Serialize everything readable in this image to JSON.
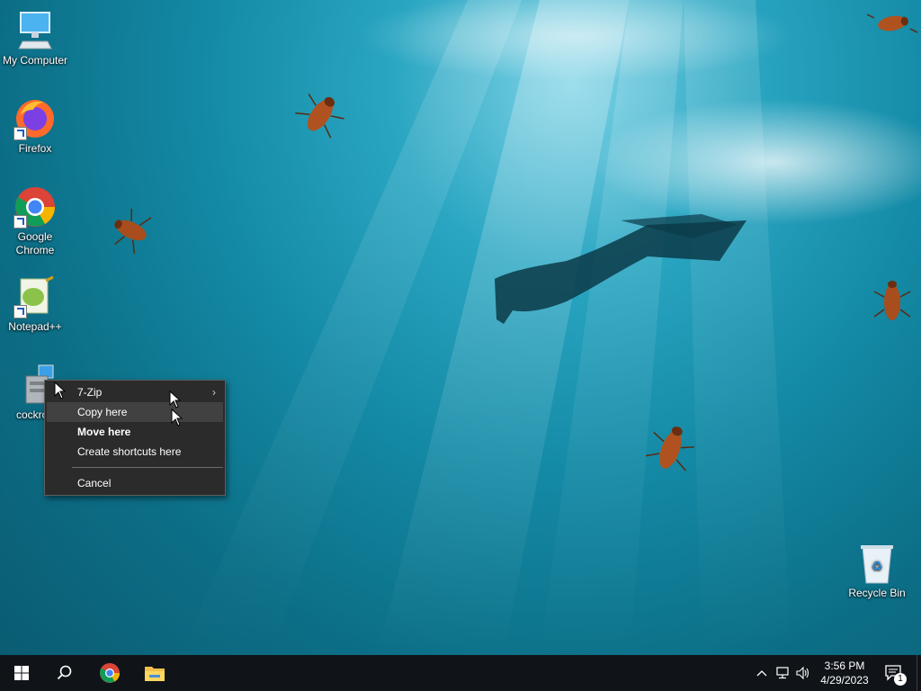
{
  "desktop_icons": [
    {
      "label": "My Computer",
      "icon": "computer-icon"
    },
    {
      "label": "Firefox",
      "icon": "firefox-icon"
    },
    {
      "label": "Google Chrome",
      "icon": "chrome-icon"
    },
    {
      "label": "Notepad++",
      "icon": "notepadpp-icon"
    },
    {
      "label": "cockroa",
      "icon": "installer-icon"
    },
    {
      "label": "Recycle Bin",
      "icon": "recycle-bin-icon"
    }
  ],
  "context_menu": {
    "items": [
      {
        "label": "7-Zip",
        "submenu_arrow": "›"
      },
      {
        "label": "Copy here"
      },
      {
        "label": "Move here"
      },
      {
        "label": "Create shortcuts here"
      },
      {
        "label": "Cancel"
      }
    ]
  },
  "taskbar": {
    "clock_time": "3:56 PM",
    "clock_date": "4/29/2023",
    "notification_count": "1",
    "pinned": [
      "start-icon",
      "search-icon",
      "chrome-icon",
      "file-explorer-icon"
    ]
  },
  "colors": {
    "taskbar": "#101419",
    "menu_bg": "#2b2b2b",
    "menu_hover": "#414141",
    "water": "#148aa6"
  }
}
